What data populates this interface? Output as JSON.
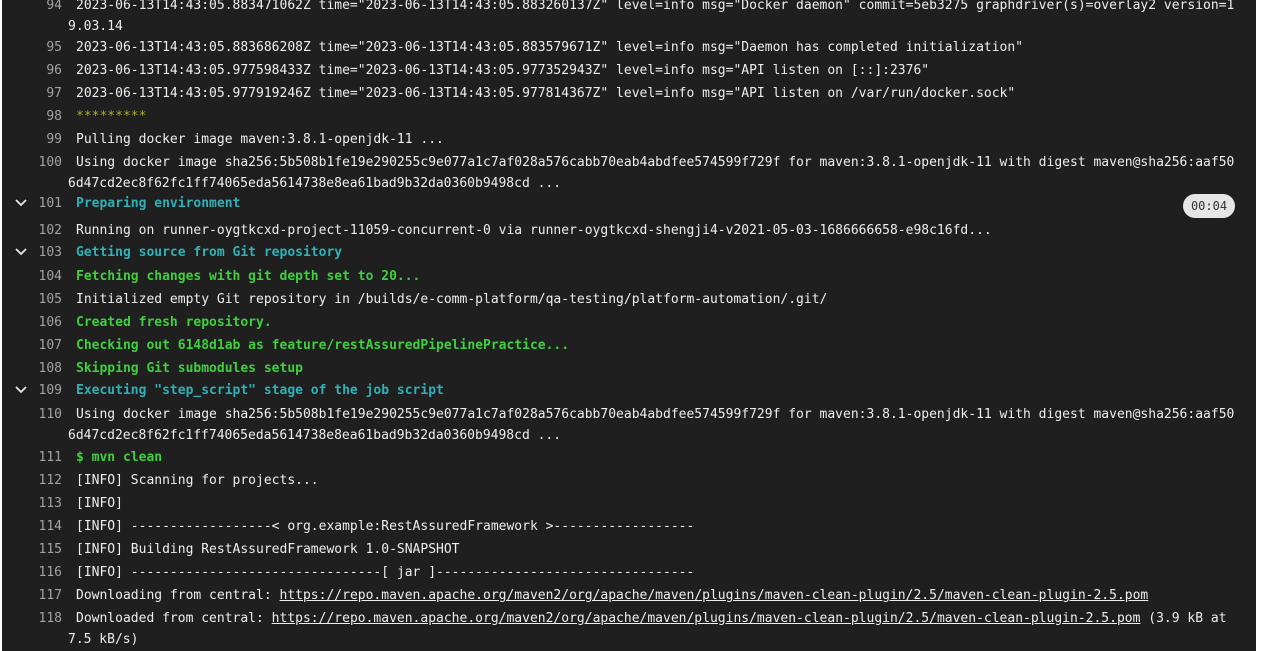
{
  "job_log": {
    "line_94": {
      "num": "94",
      "l1": "2023-06-13T14:43:05.883471062Z time=\"2023-06-13T14:43:05.883260137Z\" level=info msg=\"Docker daemon\" commit=5eb3275 graphdriver(s)=overlay2 version=1",
      "l2": "9.03.14"
    },
    "line_95": {
      "num": "95",
      "text": "2023-06-13T14:43:05.883686208Z time=\"2023-06-13T14:43:05.883579671Z\" level=info msg=\"Daemon has completed initialization\""
    },
    "line_96": {
      "num": "96",
      "text": "2023-06-13T14:43:05.977598433Z time=\"2023-06-13T14:43:05.977352943Z\" level=info msg=\"API listen on [::]:2376\""
    },
    "line_97": {
      "num": "97",
      "text": "2023-06-13T14:43:05.977919246Z time=\"2023-06-13T14:43:05.977814367Z\" level=info msg=\"API listen on /var/run/docker.sock\""
    },
    "line_98": {
      "num": "98",
      "text": "*********"
    },
    "line_99": {
      "num": "99",
      "text": "Pulling docker image maven:3.8.1-openjdk-11 ..."
    },
    "line_100": {
      "num": "100",
      "l1": "Using docker image sha256:5b508b1fe19e290255c9e077a1c7af028a576cabb70eab4abdfee574599f729f for maven:3.8.1-openjdk-11 with digest maven@sha256:aaf50",
      "l2": "6d47cd2ec8f62fc1ff74065eda5614738e8ea61bad9b32da0360b9498cd ..."
    },
    "line_101": {
      "num": "101",
      "text": "Preparing environment",
      "duration": "00:04"
    },
    "line_102": {
      "num": "102",
      "text": "Running on runner-oygtkcxd-project-11059-concurrent-0 via runner-oygtkcxd-shengji4-v2021-05-03-1686666658-e98c16fd..."
    },
    "line_103": {
      "num": "103",
      "text": "Getting source from Git repository"
    },
    "line_104": {
      "num": "104",
      "text": "Fetching changes with git depth set to 20..."
    },
    "line_105": {
      "num": "105",
      "text": "Initialized empty Git repository in /builds/e-comm-platform/qa-testing/platform-automation/.git/"
    },
    "line_106": {
      "num": "106",
      "text": "Created fresh repository."
    },
    "line_107": {
      "num": "107",
      "text": "Checking out 6148d1ab as feature/restAssuredPipelinePractice..."
    },
    "line_108": {
      "num": "108",
      "text": "Skipping Git submodules setup"
    },
    "line_109": {
      "num": "109",
      "text": "Executing \"step_script\" stage of the job script"
    },
    "line_110": {
      "num": "110",
      "l1": "Using docker image sha256:5b508b1fe19e290255c9e077a1c7af028a576cabb70eab4abdfee574599f729f for maven:3.8.1-openjdk-11 with digest maven@sha256:aaf50",
      "l2": "6d47cd2ec8f62fc1ff74065eda5614738e8ea61bad9b32da0360b9498cd ..."
    },
    "line_111": {
      "num": "111",
      "text": "$ mvn clean"
    },
    "line_112": {
      "num": "112",
      "text": "[INFO] Scanning for projects..."
    },
    "line_113": {
      "num": "113",
      "text": "[INFO]"
    },
    "line_114": {
      "num": "114",
      "text": "[INFO] ------------------< org.example:RestAssuredFramework >------------------"
    },
    "line_115": {
      "num": "115",
      "text": "[INFO] Building RestAssuredFramework 1.0-SNAPSHOT"
    },
    "line_116": {
      "num": "116",
      "text": "[INFO] --------------------------------[ jar ]---------------------------------"
    },
    "line_117": {
      "num": "117",
      "prefix": "Downloading from central: ",
      "url": "https://repo.maven.apache.org/maven2/org/apache/maven/plugins/maven-clean-plugin/2.5/maven-clean-plugin-2.5.pom"
    },
    "line_118": {
      "num": "118",
      "prefix": "Downloaded from central: ",
      "url": "https://repo.maven.apache.org/maven2/org/apache/maven/plugins/maven-clean-plugin/2.5/maven-clean-plugin-2.5.pom",
      "suffix": " (3.9 kB at",
      "l2": "7.5 kB/s)"
    }
  },
  "colors": {
    "background": "#1f1f1f",
    "section_header": "#2fb1b7",
    "success": "#3fcf3f",
    "separator": "#a7a92b"
  },
  "icons": {
    "section_toggle": "chevron-down-icon"
  }
}
